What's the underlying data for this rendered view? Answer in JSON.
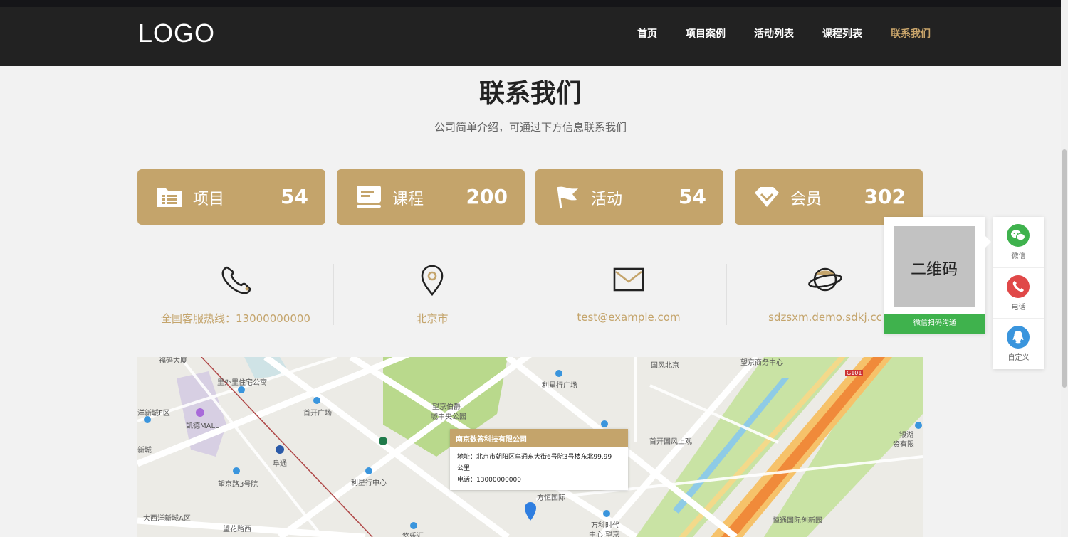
{
  "header": {
    "logo": "LOGO",
    "nav": [
      {
        "label": "首页"
      },
      {
        "label": "项目案例"
      },
      {
        "label": "活动列表"
      },
      {
        "label": "课程列表"
      },
      {
        "label": "联系我们"
      }
    ],
    "active_color": "#c8a46a"
  },
  "page": {
    "title": "联系我们",
    "subtitle": "公司简单介绍，可通过下方信息联系我们"
  },
  "stats": [
    {
      "icon": "folder-list-icon",
      "label": "项目",
      "value": "54"
    },
    {
      "icon": "course-book-icon",
      "label": "课程",
      "value": "200"
    },
    {
      "icon": "flag-icon",
      "label": "活动",
      "value": "54"
    },
    {
      "icon": "diamond-icon",
      "label": "会员",
      "value": "302"
    }
  ],
  "contacts": [
    {
      "icon": "phone-icon",
      "text": "全国客服热线：13000000000"
    },
    {
      "icon": "location-pin-icon",
      "text": "北京市"
    },
    {
      "icon": "mail-icon",
      "text": "test@example.com"
    },
    {
      "icon": "planet-icon",
      "text": "sdzsxm.demo.sdkj.cc"
    }
  ],
  "map": {
    "popup": {
      "title": "南京数答科技有限公司",
      "address_line1": "地址：北京市朝阳区阜通东大街6号院3号楼东北99.99",
      "address_line2": "公里",
      "phone": "电话：13000000000"
    },
    "labels": {
      "l1": "福码大厦",
      "l2": "里外里住宅公寓",
      "l3": "洋新城F区",
      "l4": "凯德MALL",
      "l5": "首开广场",
      "l6": "望京伯爵",
      "l7": "城中央公园",
      "l8": "利星行广场",
      "l9": "国风北京",
      "l10": "望京商务中心",
      "l11": "首开国风上观",
      "l12": "阜通",
      "l13": "望京路3号院",
      "l14": "利星行中心",
      "l15": "方恒国际",
      "l16": "大西洋新城A区",
      "l17": "望花路西",
      "l18": "万科时代",
      "l19": "中心·望京",
      "l20": "恒通国际创新园",
      "l21": "银湖",
      "l22": "资有限",
      "l23": "新城",
      "l24": "G101",
      "l25": "悠乐汇"
    }
  },
  "widgets": {
    "qr_placeholder": "二维码",
    "qr_caption": "微信扫码沟通",
    "side": [
      {
        "icon": "wechat-icon",
        "label": "微信",
        "color": "#3fb24d"
      },
      {
        "icon": "phone-icon",
        "label": "电话",
        "color": "#e04848"
      },
      {
        "icon": "qq-icon",
        "label": "自定义",
        "color": "#3a95dd"
      }
    ]
  },
  "colors": {
    "accent": "#c4a46b",
    "header_bg": "#222222",
    "page_bg": "#f2f2f2"
  }
}
